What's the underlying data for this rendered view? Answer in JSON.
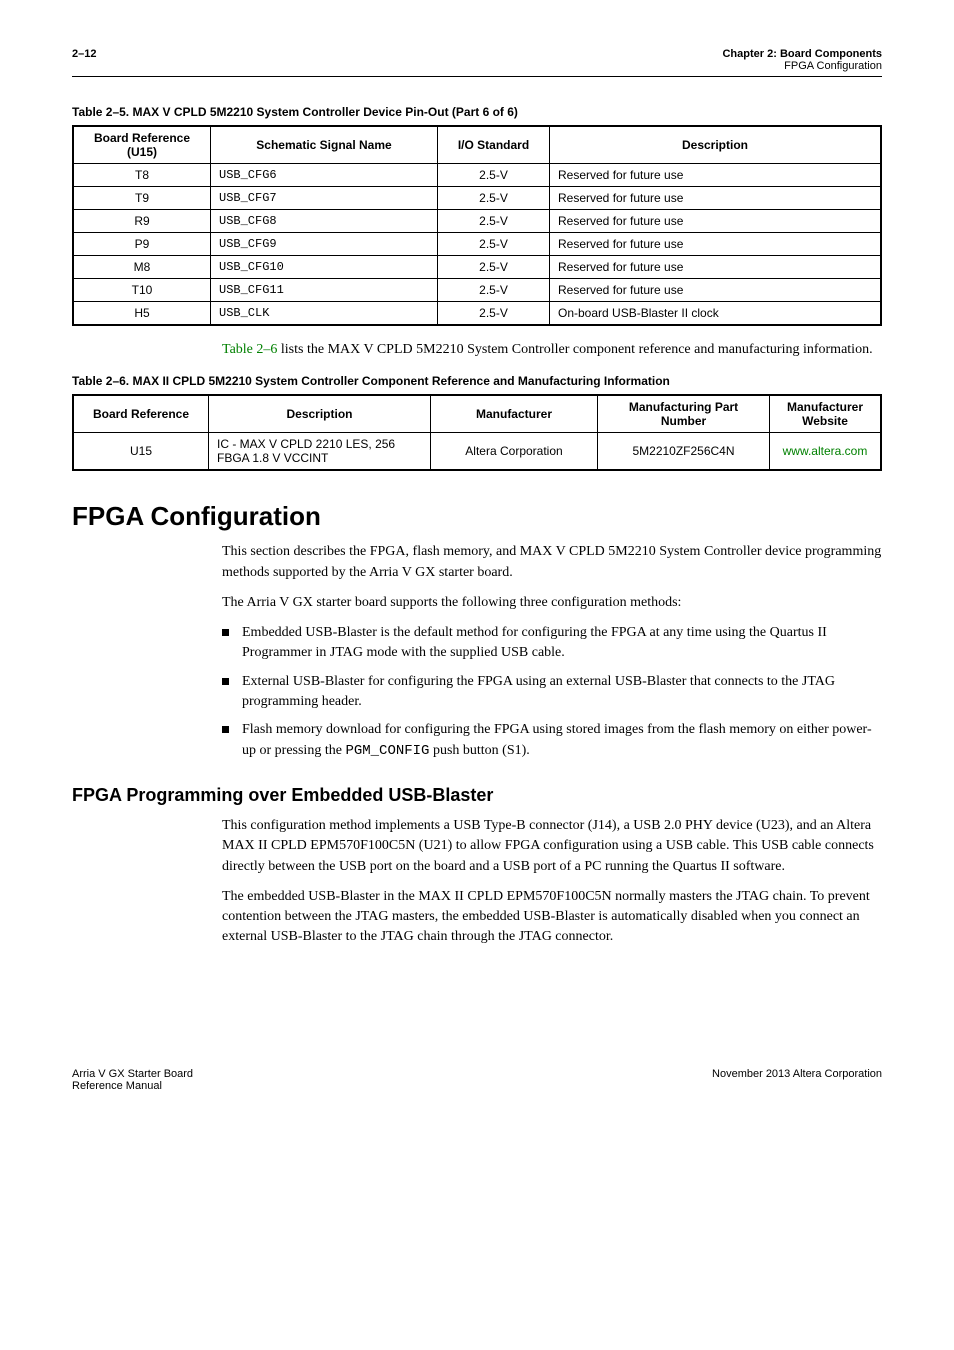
{
  "header": {
    "page_num": "2–12",
    "chapter_line": "Chapter 2: Board Components",
    "section_line": "FPGA Configuration"
  },
  "table1": {
    "caption": "Table 2–5. MAX V CPLD 5M2210 System Controller Device Pin-Out  (Part 6 of 6)",
    "cols": [
      "Board Reference (U15)",
      "Schematic Signal Name",
      "I/O Standard",
      "Description"
    ],
    "rows": [
      [
        "T8",
        "USB_CFG6",
        "2.5-V",
        "Reserved for future use"
      ],
      [
        "T9",
        "USB_CFG7",
        "2.5-V",
        "Reserved for future use"
      ],
      [
        "R9",
        "USB_CFG8",
        "2.5-V",
        "Reserved for future use"
      ],
      [
        "P9",
        "USB_CFG9",
        "2.5-V",
        "Reserved for future use"
      ],
      [
        "M8",
        "USB_CFG10",
        "2.5-V",
        "Reserved for future use"
      ],
      [
        "T10",
        "USB_CFG11",
        "2.5-V",
        "Reserved for future use"
      ],
      [
        "H5",
        "USB_CLK",
        "2.5-V",
        "On-board USB-Blaster II clock"
      ]
    ]
  },
  "para_between": {
    "xref": "Table 2–6",
    "rest": " lists the MAX V CPLD 5M2210 System Controller component reference and manufacturing information."
  },
  "table2": {
    "caption": "Table 2–6. MAX II CPLD 5M2210 System Controller Component Reference and Manufacturing Information",
    "cols": [
      "Board Reference",
      "Description",
      "Manufacturer",
      "Manufacturing Part Number",
      "Manufacturer Website"
    ],
    "row": {
      "ref": "U15",
      "desc": "IC - MAX V CPLD 2210 LES, 256 FBGA 1.8 V VCCINT",
      "mfr": "Altera Corporation",
      "part": "5M2210ZF256C4N",
      "site": "www.altera.com"
    }
  },
  "section_heading": "FPGA Configuration",
  "section_body": {
    "p1": "This section describes the FPGA, flash memory, and MAX V CPLD 5M2210 System Controller device programming methods supported by the Arria V GX starter board.",
    "p2": "The Arria V GX starter board supports the following three configuration methods:",
    "bullets": [
      "Embedded USB-Blaster is the default method for configuring the FPGA at any time using the Quartus II Programmer in JTAG mode with the supplied USB cable.",
      "External USB-Blaster for configuring the FPGA using an external USB-Blaster that connects to the JTAG programming header."
    ],
    "bullet3_pre": "Flash memory download for configuring the FPGA using stored images from the flash memory on either power-up or pressing the ",
    "bullet3_code": "PGM_CONFIG",
    "bullet3_post": " push button (S1)."
  },
  "subsection_heading": "FPGA Programming over Embedded USB-Blaster",
  "subsection_body": {
    "p1": "This configuration method implements a USB Type-B connector (J14), a USB 2.0 PHY device (U23), and an Altera MAX II CPLD EPM570F100C5N (U21) to allow FPGA configuration using a USB cable. This USB cable connects directly between the USB port on the board and a USB port of a PC running the Quartus II software.",
    "p2": "The embedded USB-Blaster in the MAX II CPLD EPM570F100C5N normally masters the JTAG chain. To prevent contention between the JTAG masters, the embedded USB-Blaster is automatically disabled when you connect an external USB-Blaster to the JTAG chain through the JTAG connector."
  },
  "footer": {
    "left1": "Arria V GX Starter Board",
    "left2": "Reference Manual",
    "right": "November 2013   Altera Corporation"
  }
}
